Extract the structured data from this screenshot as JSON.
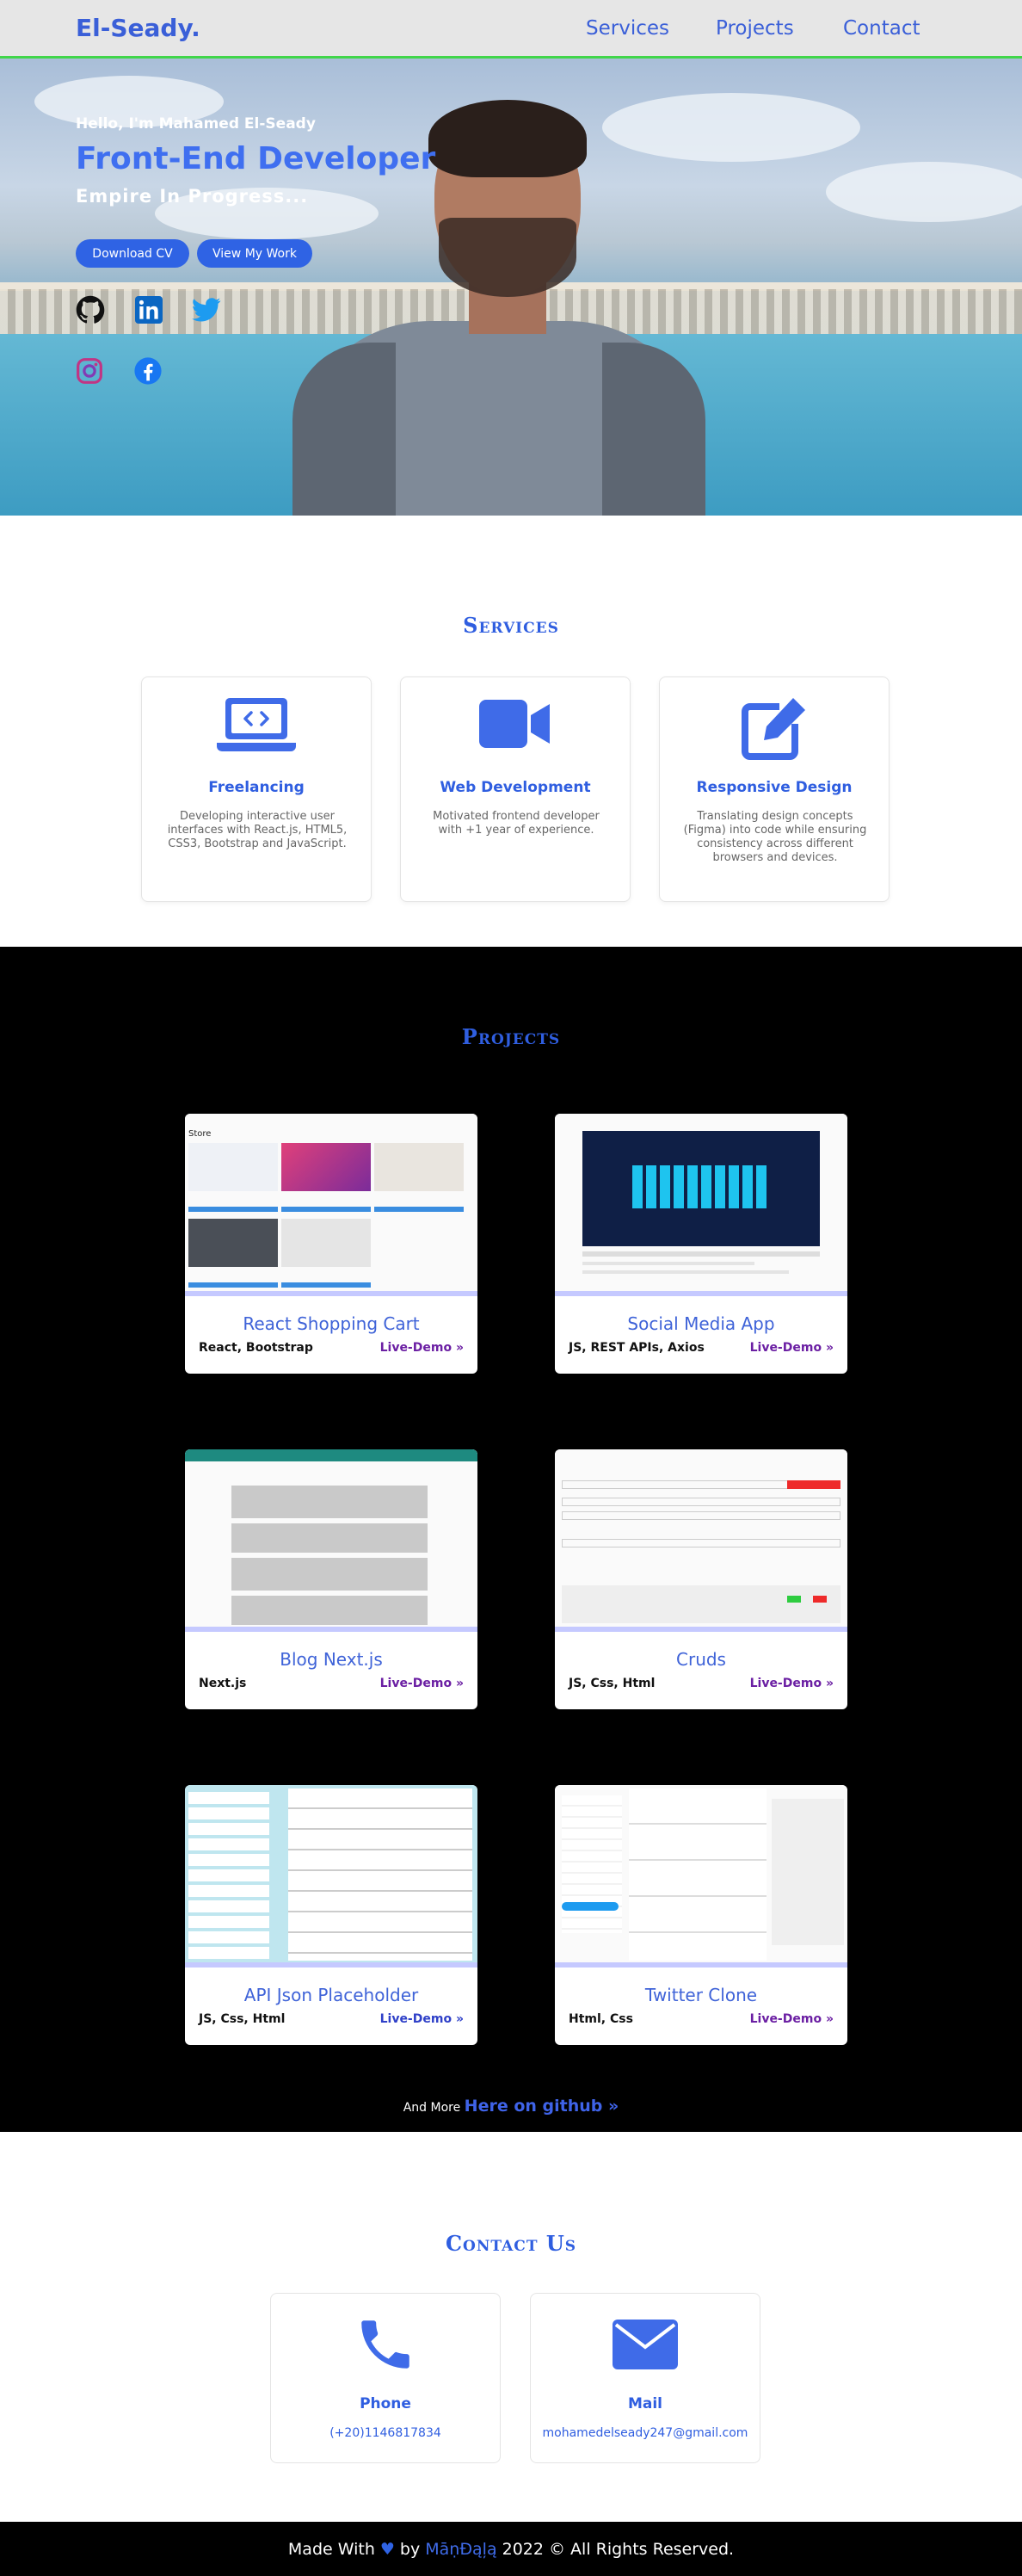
{
  "nav": {
    "logo": "El-Seady.",
    "links": [
      "Services",
      "Projects",
      "Contact"
    ]
  },
  "hero": {
    "hello": "Hello, I'm Mahamed El-Seady",
    "title": "Front-End Developer",
    "subtitle": "Empire In Progress...",
    "download_btn": "Download CV",
    "work_btn": "View My Work",
    "socials": [
      "github-icon",
      "linkedin-icon",
      "twitter-icon",
      "instagram-icon",
      "facebook-icon"
    ]
  },
  "services": {
    "title": "Services",
    "items": [
      {
        "icon": "laptop-code-icon",
        "title": "Freelancing",
        "desc": "Developing interactive user interfaces with React.js, HTML5, CSS3, Bootstrap and JavaScript."
      },
      {
        "icon": "video-camera-icon",
        "title": "Web Development",
        "desc": "Motivated frontend developer with +1 year of experience."
      },
      {
        "icon": "edit-icon",
        "title": "Responsive Design",
        "desc": "Translating design concepts (Figma) into code while ensuring consistency across different browsers and devices."
      }
    ]
  },
  "projects": {
    "title": "Projects",
    "live_label": "Live-Demo",
    "items": [
      {
        "name": "React Shopping Cart",
        "tech": "React, Bootstrap"
      },
      {
        "name": "Social Media App",
        "tech": "JS, REST APIs, Axios"
      },
      {
        "name": "Blog Next.js",
        "tech": "Next.js"
      },
      {
        "name": "Cruds",
        "tech": "JS, Css, Html"
      },
      {
        "name": "API Json Placeholder",
        "tech": "JS, Css, Html"
      },
      {
        "name": "Twitter Clone",
        "tech": "Html, Css"
      }
    ],
    "more_prefix": "And More",
    "more_link": "Here on github"
  },
  "contact": {
    "title": "Contact Us",
    "items": [
      {
        "icon": "phone-icon",
        "title": "Phone",
        "value": "(+20)1146817834"
      },
      {
        "icon": "mail-icon",
        "title": "Mail",
        "value": "mohamedelseady247@gmail.com"
      }
    ]
  },
  "footer": {
    "made_with": "Made With",
    "by": "by",
    "author": "MāṇĐąļą",
    "rights": "2022 © All Rights Reserved."
  },
  "colors": {
    "accent": "#2f5ee0",
    "nav_bg": "#e6e6e6",
    "nav_border": "#41d64a",
    "live_demo": "#6b1fa3"
  }
}
